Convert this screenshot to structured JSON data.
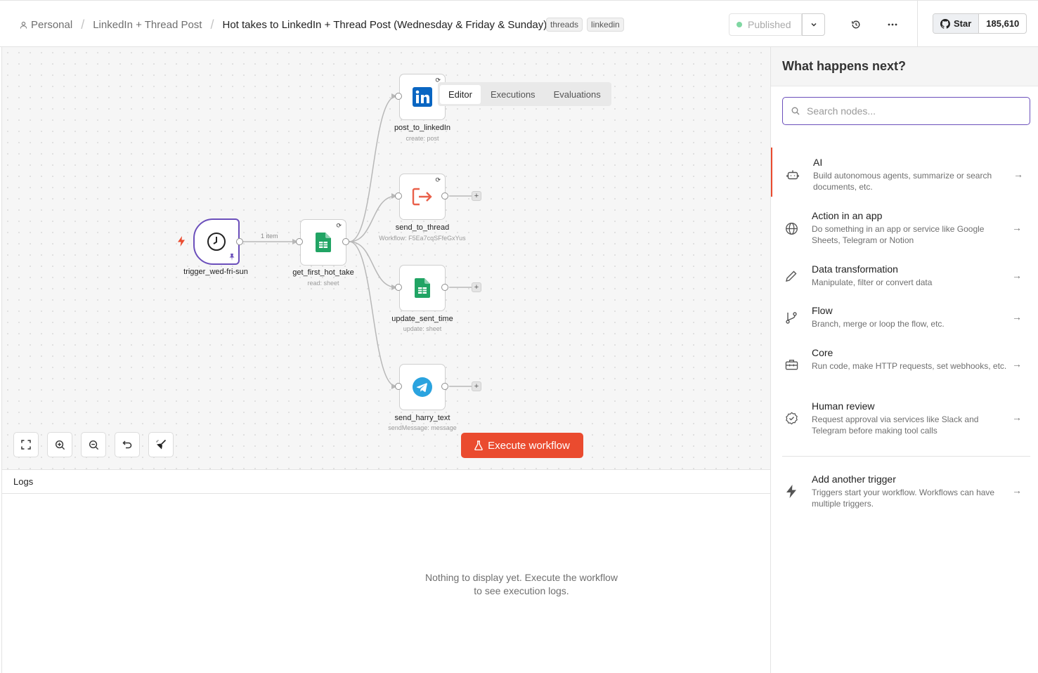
{
  "breadcrumb": {
    "personal": "Personal",
    "project": "LinkedIn + Thread Post",
    "workflow_name": "Hot takes to LinkedIn + Thread Post (Wednesday & Friday & Sunday)"
  },
  "tags": [
    "threads",
    "linkedin"
  ],
  "header": {
    "published_label": "Published",
    "github_star_label": "Star",
    "github_star_count": "185,610"
  },
  "tabs": [
    "Editor",
    "Executions",
    "Evaluations"
  ],
  "active_tab": "Editor",
  "nodes": {
    "trigger": {
      "name": "trigger_wed-fri-sun"
    },
    "sheet_read": {
      "name": "get_first_hot_take",
      "sub": "read: sheet"
    },
    "linkedin": {
      "name": "post_to_linkedIn",
      "sub": "create: post"
    },
    "thread": {
      "name": "send_to_thread",
      "sub": "Workflow: F5Ea7cqSFfeGxYus"
    },
    "sheet_update": {
      "name": "update_sent_time",
      "sub": "update: sheet"
    },
    "telegram": {
      "name": "send_harry_text",
      "sub": "sendMessage: message"
    }
  },
  "edge_label": "1 item",
  "execute_label": "Execute workflow",
  "logs": {
    "title": "Logs",
    "empty": "Nothing to display yet. Execute the workflow to see execution logs."
  },
  "panel": {
    "title": "What happens next?",
    "search_placeholder": "Search nodes...",
    "categories": [
      {
        "title": "AI",
        "desc": "Build autonomous agents, summarize or search documents, etc.",
        "icon": "robot-icon"
      },
      {
        "title": "Action in an app",
        "desc": "Do something in an app or service like Google Sheets, Telegram or Notion",
        "icon": "globe-icon"
      },
      {
        "title": "Data transformation",
        "desc": "Manipulate, filter or convert data",
        "icon": "pen-icon"
      },
      {
        "title": "Flow",
        "desc": "Branch, merge or loop the flow, etc.",
        "icon": "branch-icon"
      },
      {
        "title": "Core",
        "desc": "Run code, make HTTP requests, set webhooks, etc.",
        "icon": "toolbox-icon"
      },
      {
        "title": "Human review",
        "desc": "Request approval via services like Slack and Telegram before making tool calls",
        "icon": "check-badge-icon"
      }
    ],
    "trigger": {
      "title": "Add another trigger",
      "desc": "Triggers start your workflow. Workflows can have multiple triggers.",
      "icon": "bolt-icon"
    }
  },
  "colors": {
    "accent": "#ea4b2f",
    "purple": "#6b4fbb",
    "sheets": "#21a464",
    "linkedin": "#0a66c2",
    "telegram": "#2aa3df"
  }
}
